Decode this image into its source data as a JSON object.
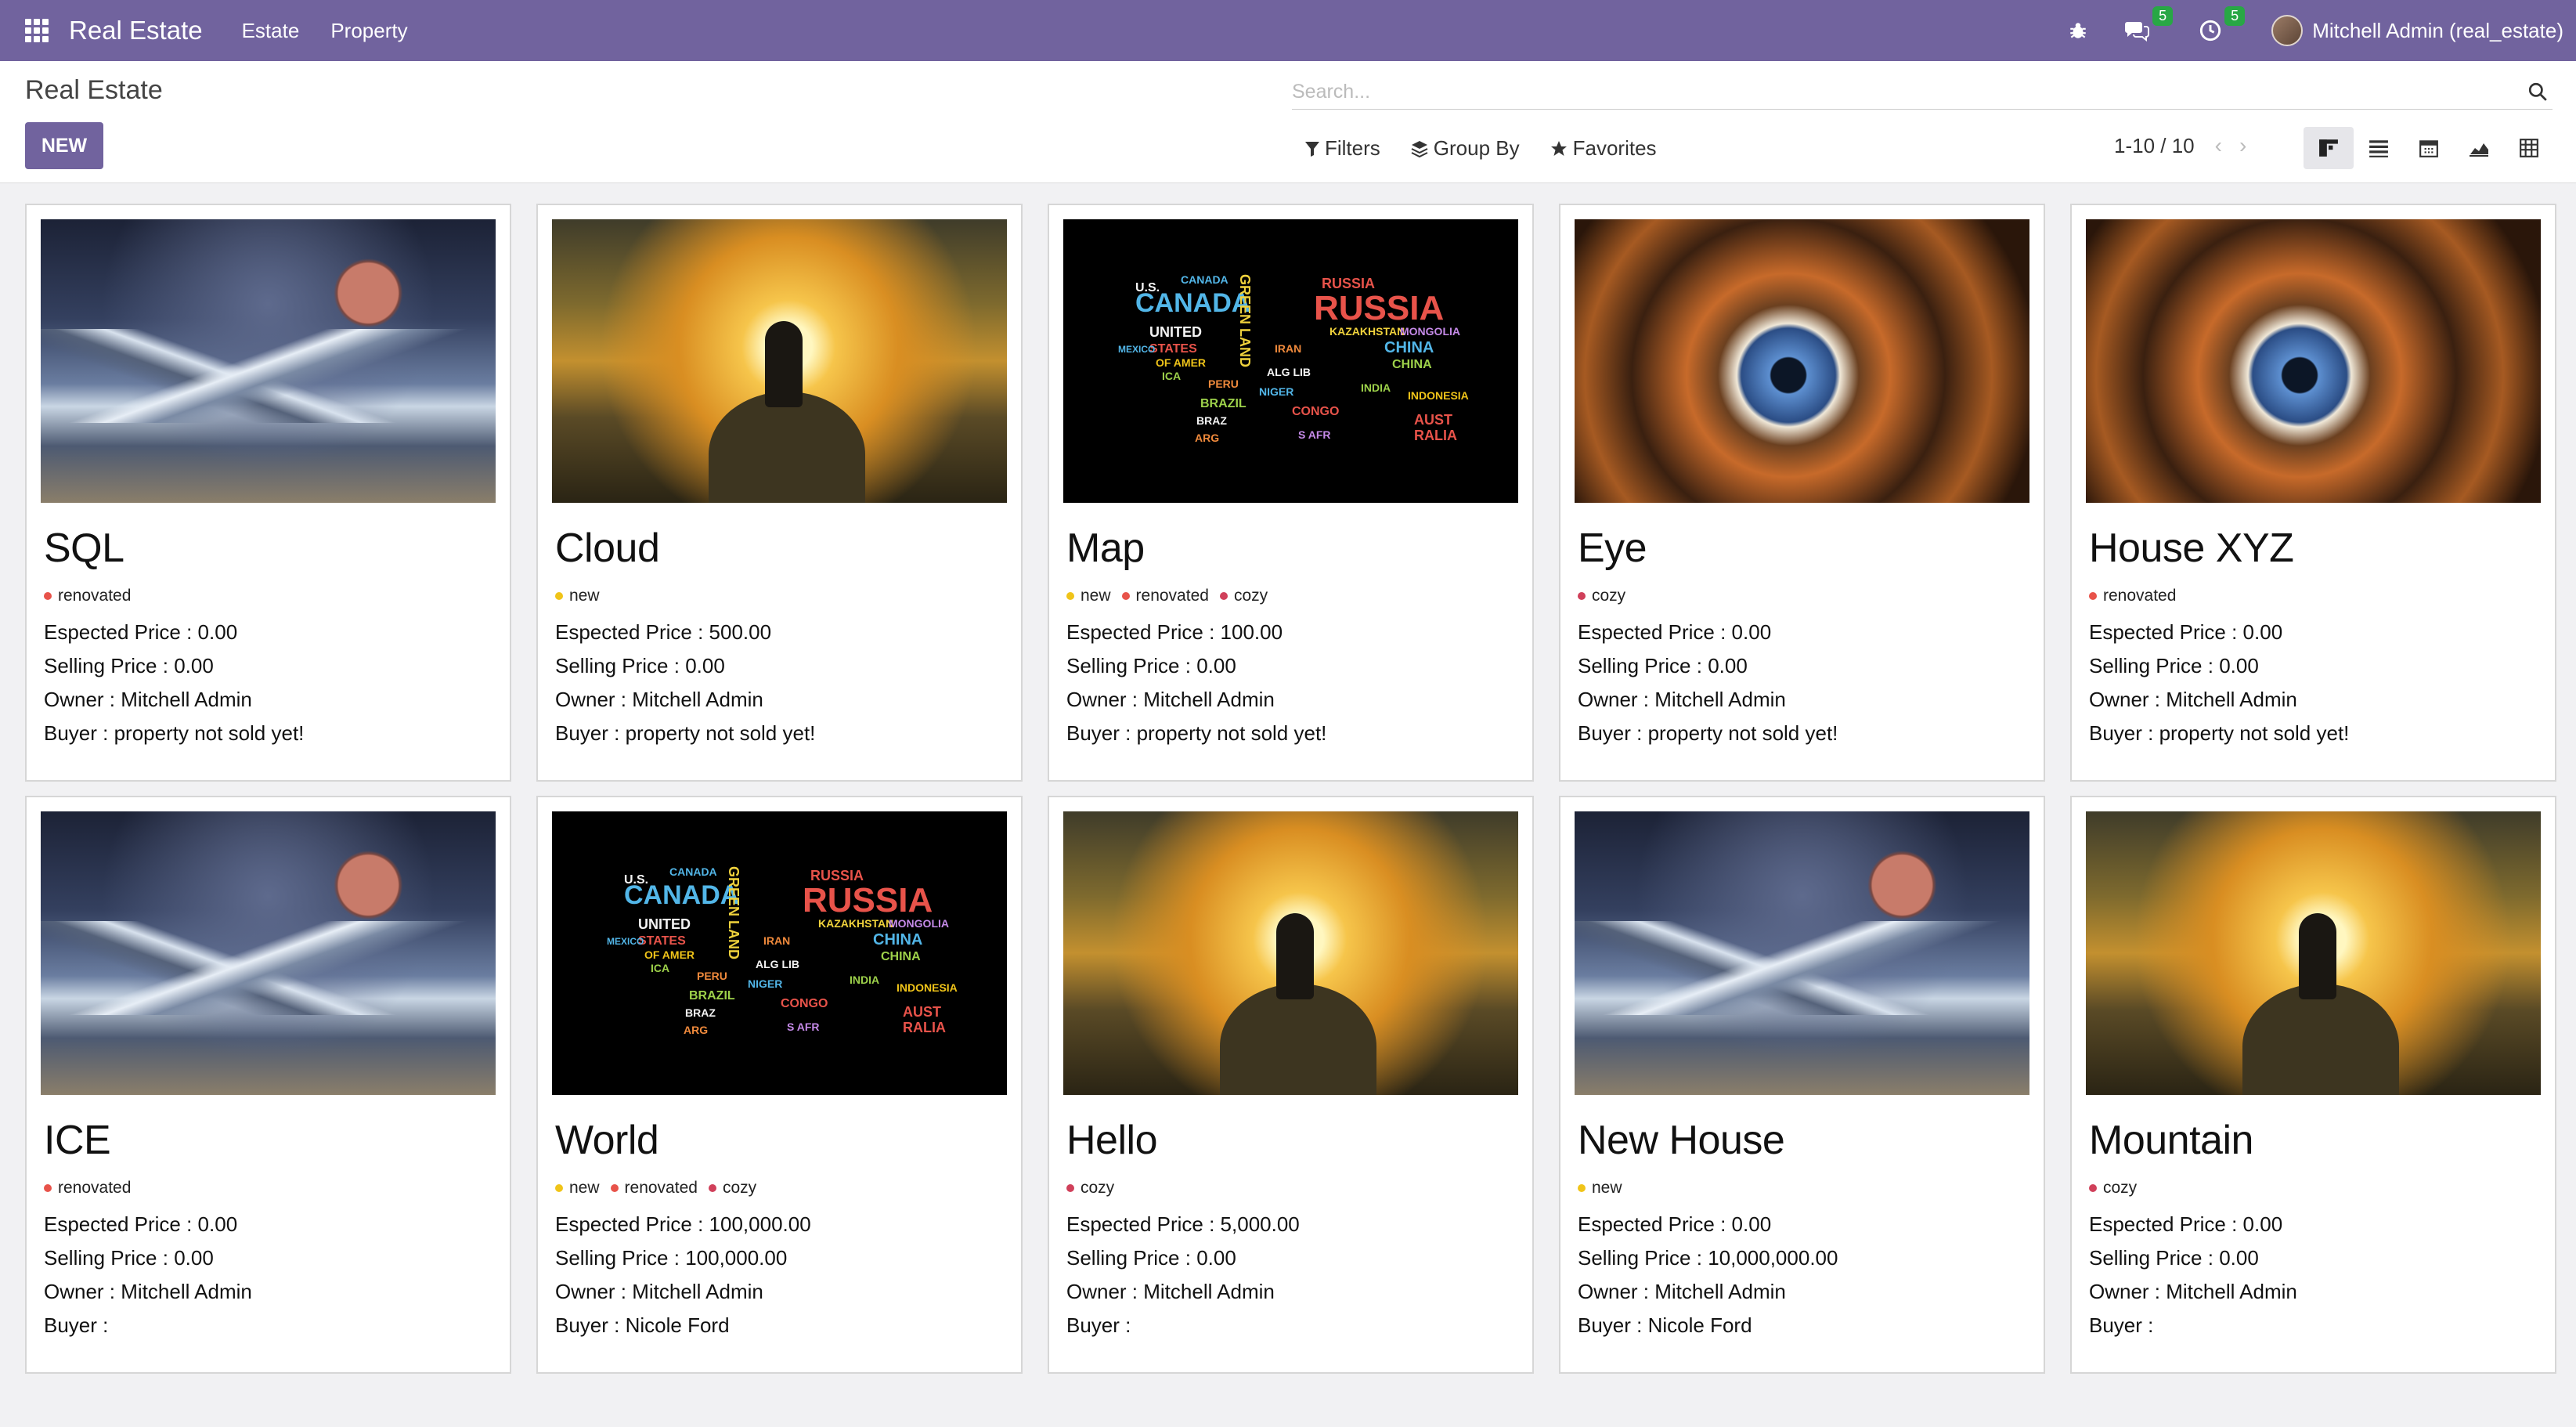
{
  "navbar": {
    "brand": "Real Estate",
    "menu": [
      "Estate",
      "Property"
    ],
    "messages_count": "5",
    "activities_count": "5",
    "user": "Mitchell Admin (real_estate)"
  },
  "control_panel": {
    "breadcrumb": "Real Estate",
    "new_label": "NEW",
    "search_placeholder": "Search...",
    "filters_label": "Filters",
    "group_by_label": "Group By",
    "favorites_label": "Favorites",
    "pager": "1-10 / 10"
  },
  "labels": {
    "expected": "Espected Price : ",
    "selling": "Selling Price : ",
    "owner": "Owner : ",
    "buyer": "Buyer : "
  },
  "colors": {
    "brand": "#71639e",
    "tag_new": "#f0c419",
    "tag_renovated": "#e8534a",
    "tag_cozy": "#d0405a"
  },
  "cards": [
    {
      "name": "SQL",
      "image": "space",
      "tags": [
        "renovated"
      ],
      "expected": "0.00",
      "selling": "0.00",
      "owner": "Mitchell Admin",
      "buyer": "property not sold yet!"
    },
    {
      "name": "Cloud",
      "image": "sunset",
      "tags": [
        "new"
      ],
      "expected": "500.00",
      "selling": "0.00",
      "owner": "Mitchell Admin",
      "buyer": "property not sold yet!"
    },
    {
      "name": "Map",
      "image": "map",
      "tags": [
        "new",
        "renovated",
        "cozy"
      ],
      "expected": "100.00",
      "selling": "0.00",
      "owner": "Mitchell Admin",
      "buyer": "property not sold yet!"
    },
    {
      "name": "Eye",
      "image": "eye",
      "tags": [
        "cozy"
      ],
      "expected": "0.00",
      "selling": "0.00",
      "owner": "Mitchell Admin",
      "buyer": "property not sold yet!"
    },
    {
      "name": "House XYZ",
      "image": "eye",
      "tags": [
        "renovated"
      ],
      "expected": "0.00",
      "selling": "0.00",
      "owner": "Mitchell Admin",
      "buyer": "property not sold yet!"
    },
    {
      "name": "ICE",
      "image": "space",
      "tags": [
        "renovated"
      ],
      "expected": "0.00",
      "selling": "0.00",
      "owner": "Mitchell Admin",
      "buyer": ""
    },
    {
      "name": "World",
      "image": "map",
      "tags": [
        "new",
        "renovated",
        "cozy"
      ],
      "expected": "100,000.00",
      "selling": "100,000.00",
      "owner": "Mitchell Admin",
      "buyer": "Nicole Ford"
    },
    {
      "name": "Hello",
      "image": "sunset",
      "tags": [
        "cozy"
      ],
      "expected": "5,000.00",
      "selling": "0.00",
      "owner": "Mitchell Admin",
      "buyer": ""
    },
    {
      "name": "New House",
      "image": "space",
      "tags": [
        "new"
      ],
      "expected": "0.00",
      "selling": "10,000,000.00",
      "owner": "Mitchell Admin",
      "buyer": "Nicole Ford"
    },
    {
      "name": "Mountain",
      "image": "sunset",
      "tags": [
        "cozy"
      ],
      "expected": "0.00",
      "selling": "0.00",
      "owner": "Mitchell Admin",
      "buyer": ""
    }
  ]
}
